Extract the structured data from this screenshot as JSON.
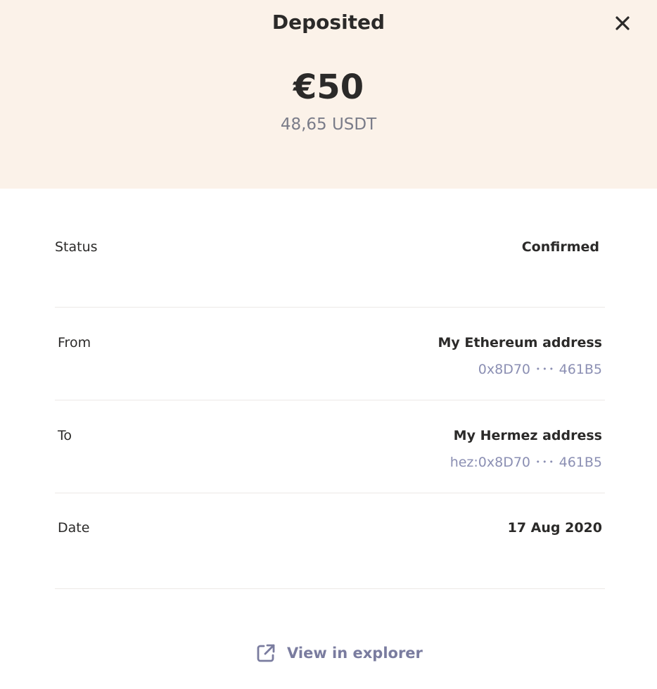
{
  "header": {
    "title": "Deposited",
    "fiat_amount": "€50",
    "token_amount": "48,65 USDT",
    "background_color": "#fbf2e9",
    "close_icon": "close-icon"
  },
  "details": {
    "status": {
      "label": "Status",
      "value": "Confirmed"
    },
    "from": {
      "label": "From",
      "value": "My Ethereum address",
      "address": "0x8D70 ･･･ 461B5"
    },
    "to": {
      "label": "To",
      "value": "My Hermez address",
      "address": "hez:0x8D70 ･･･ 461B5"
    },
    "date": {
      "label": "Date",
      "value": "17 Aug 2020"
    }
  },
  "footer": {
    "explorer_label": "View in explorer",
    "explorer_icon": "external-link-icon",
    "link_color": "#7a7c9f"
  }
}
